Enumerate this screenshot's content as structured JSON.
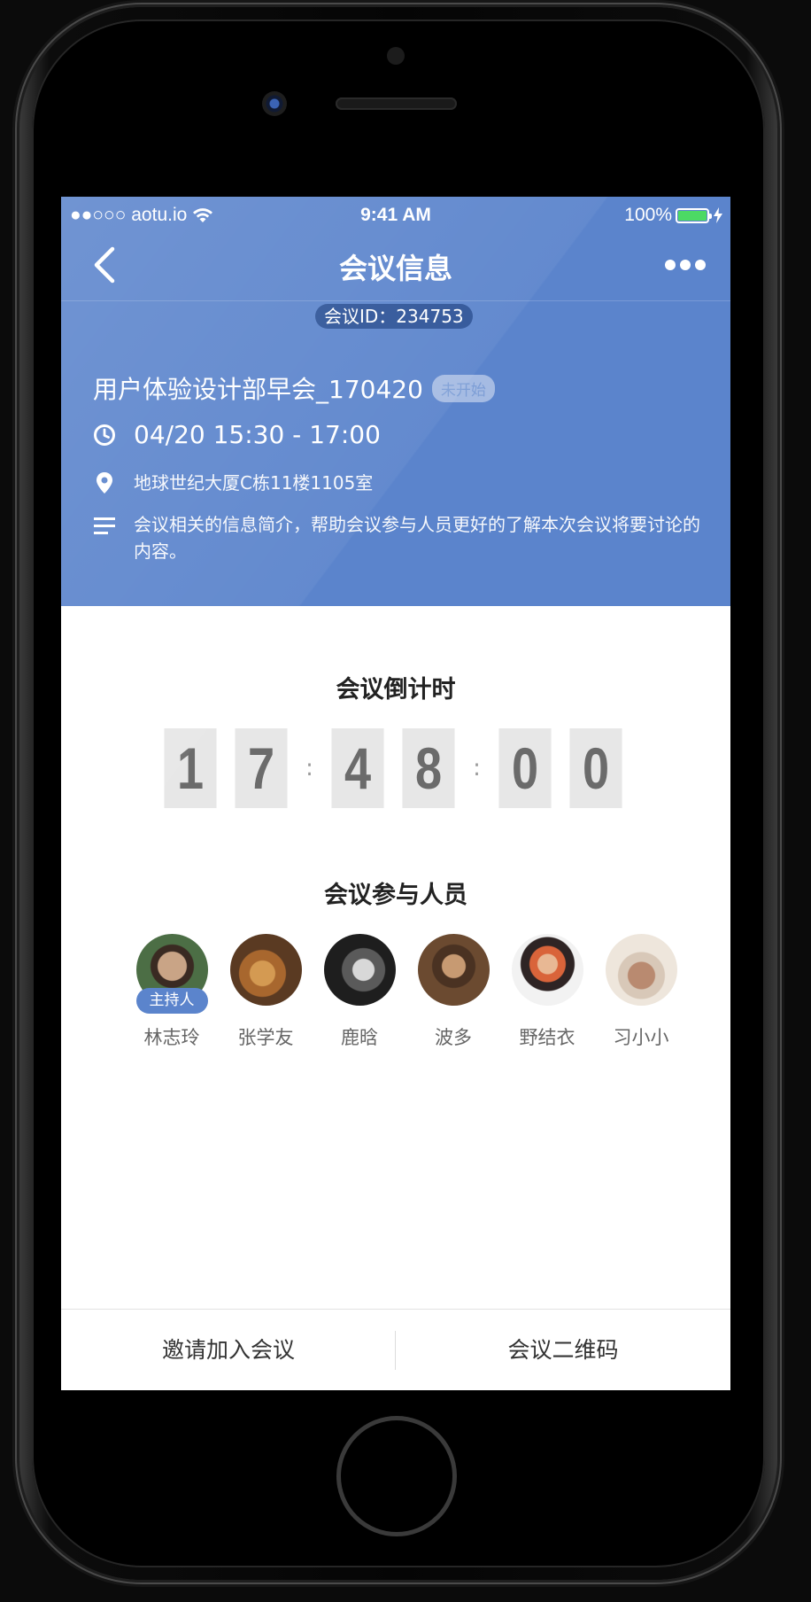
{
  "status_bar": {
    "carrier": "●●○○○ aotu.io",
    "time": "9:41 AM",
    "battery_percent": "100%",
    "battery_level": 1.0,
    "battery_color": "#4cd964"
  },
  "navbar": {
    "title": "会议信息",
    "back_icon": "chevron-left-icon",
    "more_icon": "ellipsis-icon"
  },
  "meeting": {
    "id_label": "会议ID：234753",
    "title": "用户体验设计部早会_170420",
    "status": "未开始",
    "time": "04/20 15:30 - 17:00",
    "location": "地球世纪大厦C栋11楼1105室",
    "description": "会议相关的信息简介，帮助会议参与人员更好的了解本次会议将要讨论的内容。"
  },
  "countdown": {
    "title": "会议倒计时",
    "digits": [
      "1",
      "7",
      "4",
      "8",
      "0",
      "0"
    ],
    "separator": ":"
  },
  "participants": {
    "title": "会议参与人员",
    "host_label": "主持人",
    "people": [
      {
        "name": "林志玲",
        "host": true
      },
      {
        "name": "张学友",
        "host": false
      },
      {
        "name": "鹿晗",
        "host": false
      },
      {
        "name": "波多",
        "host": false
      },
      {
        "name": "野结衣",
        "host": false
      },
      {
        "name": "习小小",
        "host": false
      }
    ]
  },
  "bottom_bar": {
    "invite_label": "邀请加入会议",
    "qrcode_label": "会议二维码"
  },
  "colors": {
    "header_blue": "#5b84cc",
    "id_pill": "#2c5297",
    "digit_bg": "#e7e7e7"
  }
}
